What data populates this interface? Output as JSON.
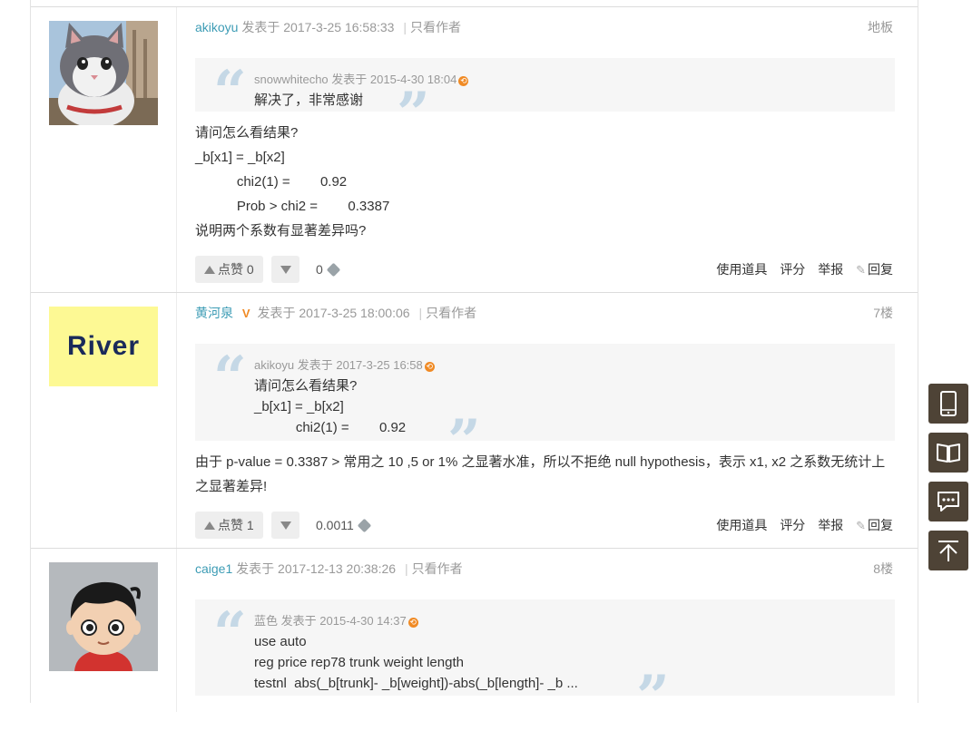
{
  "posts": [
    {
      "author": "akikoyu",
      "posted_prefix": "发表于",
      "posted_time": "2017-3-25 16:58:33",
      "only_author": "只看作者",
      "floor": "地板",
      "quote": {
        "user": "snowwhitecho",
        "posted_prefix": "发表于",
        "time": "2015-4-30 18:04",
        "lines": [
          "解决了，非常感谢"
        ]
      },
      "content_lines": [
        "请问怎么看结果?",
        "_b[x1] = _b[x2]",
        "           chi2(1) =        0.92",
        "           Prob > chi2 =        0.3387",
        "说明两个系数有显著差异吗?"
      ],
      "like_label": "点赞 0",
      "coins": "0",
      "tools": [
        "使用道具",
        "评分",
        "举报"
      ],
      "reply": "回复"
    },
    {
      "author": "黄河泉",
      "posted_prefix": "发表于",
      "posted_time": "2017-3-25 18:00:06",
      "only_author": "只看作者",
      "floor": "7楼",
      "avatar_text": "River",
      "quote": {
        "user": "akikoyu",
        "posted_prefix": "发表于",
        "time": "2017-3-25 16:58",
        "lines": [
          "请问怎么看结果?",
          "_b[x1] = _b[x2]",
          "           chi2(1) =        0.92"
        ]
      },
      "content_text": "由于 p-value = 0.3387 > 常用之 10 ,5 or 1% 之显著水准，所以不拒绝 null hypothesis，表示 x1, x2 之系数无统计上之显著差异!",
      "like_label": "点赞 1",
      "coins": "0.0011",
      "tools": [
        "使用道具",
        "评分",
        "举报"
      ],
      "reply": "回复"
    },
    {
      "author": "caige1",
      "posted_prefix": "发表于",
      "posted_time": "2017-12-13 20:38:26",
      "only_author": "只看作者",
      "floor": "8楼",
      "quote": {
        "user": "蓝色",
        "posted_prefix": "发表于",
        "time": "2015-4-30 14:37",
        "lines": [
          "use auto",
          "reg price rep78 trunk weight length",
          "testnl  abs(_b[trunk]- _b[weight])-abs(_b[length]- _b ..."
        ]
      }
    }
  ],
  "colors": {
    "author": "#3d9cb5",
    "float_bar": "#4e4336",
    "quote_mark": "#c5d8e6",
    "return_icon": "#f08a24"
  },
  "float_bar": [
    "mobile-icon",
    "book-icon",
    "chat-icon",
    "back-to-top-icon"
  ]
}
